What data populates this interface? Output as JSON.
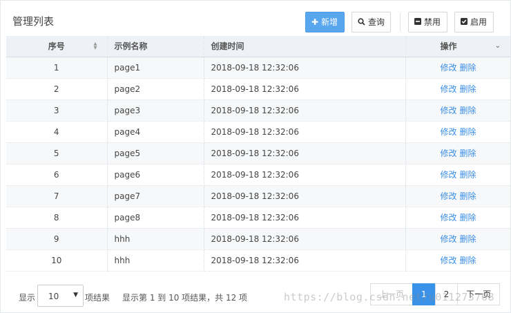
{
  "header": {
    "title": "管理列表",
    "buttons": {
      "add": "新增",
      "query": "查询",
      "disable": "禁用",
      "enable": "启用"
    }
  },
  "table": {
    "columns": {
      "index": "序号",
      "name": "示例名称",
      "created": "创建时间",
      "ops": "操作"
    },
    "actions": {
      "edit": "修改",
      "delete": "删除"
    },
    "rows": [
      {
        "index": "1",
        "name": "page1",
        "created": "2018-09-18 12:32:06"
      },
      {
        "index": "2",
        "name": "page2",
        "created": "2018-09-18 12:32:06"
      },
      {
        "index": "3",
        "name": "page3",
        "created": "2018-09-18 12:32:06"
      },
      {
        "index": "4",
        "name": "page4",
        "created": "2018-09-18 12:32:06"
      },
      {
        "index": "5",
        "name": "page5",
        "created": "2018-09-18 12:32:06"
      },
      {
        "index": "6",
        "name": "page6",
        "created": "2018-09-18 12:32:06"
      },
      {
        "index": "7",
        "name": "page7",
        "created": "2018-09-18 12:32:06"
      },
      {
        "index": "8",
        "name": "page8",
        "created": "2018-09-18 12:32:06"
      },
      {
        "index": "9",
        "name": "hhh",
        "created": "2018-09-18 12:32:06"
      },
      {
        "index": "10",
        "name": "hhh",
        "created": "2018-09-18 12:32:06"
      }
    ]
  },
  "footer": {
    "show_label": "显示",
    "page_size": "10",
    "results_label": "项结果",
    "summary": "显示第 1 到 10 项结果，共 12 项",
    "pager": {
      "prev": "上一页",
      "pages": [
        "1",
        "2"
      ],
      "next": "下一页",
      "current": "1"
    }
  },
  "watermark": "https://blog.csdn.net/u011273768",
  "colors": {
    "primary": "#58a6ee",
    "link": "#3a8ee6",
    "active_page": "#3a92e8"
  }
}
